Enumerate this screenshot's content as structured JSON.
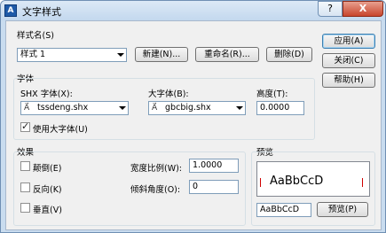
{
  "window": {
    "title": "文字样式",
    "app_icon": "A",
    "help_glyph": "?",
    "close_glyph": "X"
  },
  "style_name": {
    "group_label": "样式名(S)",
    "selected": "样式 1",
    "new_label": "新建(N)...",
    "rename_label": "重命名(R)...",
    "delete_label": "删除(D)"
  },
  "right_buttons": {
    "apply": "应用(A)",
    "close": "关闭(C)",
    "help": "帮助(H)"
  },
  "font": {
    "group_label": "字体",
    "shx_label": "SHX 字体(X):",
    "shx_value": "tssdeng.shx",
    "bigfont_label": "大字体(B):",
    "bigfont_value": "gbcbig.shx",
    "height_label": "高度(T):",
    "height_value": "0.0000",
    "use_bigfont_label": "使用大字体(U)",
    "use_bigfont_checked": true
  },
  "effects": {
    "group_label": "效果",
    "upside_down": "颠倒(E)",
    "backwards": "反向(K)",
    "vertical": "垂直(V)",
    "width_factor_label": "宽度比例(W):",
    "width_factor_value": "1.0000",
    "oblique_label": "倾斜角度(O):",
    "oblique_value": "0"
  },
  "preview": {
    "group_label": "预览",
    "sample_text": "AaBbCcD",
    "input_value": "AaBbCcD",
    "button_label": "预览(P)"
  }
}
